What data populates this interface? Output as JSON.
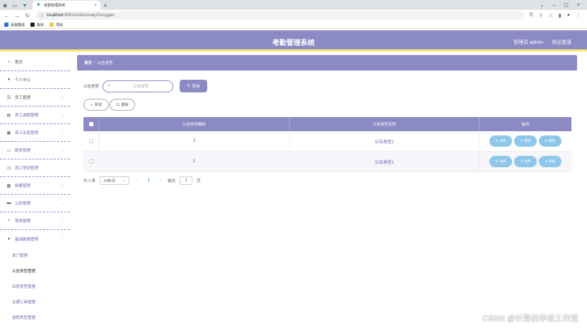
{
  "browser": {
    "tab_title": "考勤管理系统",
    "url_host": "localhost",
    "url_path": ":8081/#/dictionaryGonggao",
    "bookmarks": [
      "百度翻译",
      "撕标",
      "项目"
    ]
  },
  "header": {
    "title": "考勤管理系统",
    "user": "管理员 admin",
    "logout": "退出登录"
  },
  "sidebar": {
    "items": [
      {
        "label": "首页",
        "icon": "home-icon"
      },
      {
        "label": "个人中心",
        "icon": "user-icon"
      },
      {
        "label": "员工管理",
        "icon": "list-icon"
      },
      {
        "label": "员工请假管理",
        "icon": "doc-icon"
      },
      {
        "label": "员工出差管理",
        "icon": "trip-icon"
      },
      {
        "label": "薪资管理",
        "icon": "chat-icon"
      },
      {
        "label": "员工签到管理",
        "icon": "clock-icon"
      },
      {
        "label": "档案管理",
        "icon": "folder-icon"
      },
      {
        "label": "公告管理",
        "icon": "notice-icon"
      },
      {
        "label": "菜单管理",
        "icon": "menu-icon"
      },
      {
        "label": "基础数据管理",
        "icon": "base-icon"
      }
    ],
    "sub_items": [
      {
        "label": "部门管理",
        "active": false
      },
      {
        "label": "公告类型管理",
        "active": true
      },
      {
        "label": "出差类型管理",
        "active": false
      },
      {
        "label": "交通工具管理",
        "active": false
      },
      {
        "label": "请假类型管理",
        "active": false
      }
    ]
  },
  "breadcrumb": {
    "home": "首页",
    "current": "公告类型"
  },
  "search": {
    "label": "公告类型",
    "placeholder": "公告类型",
    "button": "查询"
  },
  "actions": {
    "add": "新增",
    "delete": "删除"
  },
  "table": {
    "headers": [
      "公告类型编码",
      "公告类型名称",
      "操作"
    ],
    "rows": [
      {
        "code": "2",
        "name": "公告类型2"
      },
      {
        "code": "1",
        "name": "公告类型1"
      }
    ],
    "ops": [
      "详情",
      "修改",
      "删除"
    ]
  },
  "pager": {
    "total": "共 2 条",
    "size": "10条/页",
    "current": "1",
    "goto_label": "前往",
    "goto_value": "1",
    "page_unit": "页"
  },
  "watermark": "CSDN @计算机毕设工作室",
  "colors": {
    "primary": "#8b8ac4",
    "accent": "#ffe86b",
    "op_button": "#8fc7ea"
  }
}
